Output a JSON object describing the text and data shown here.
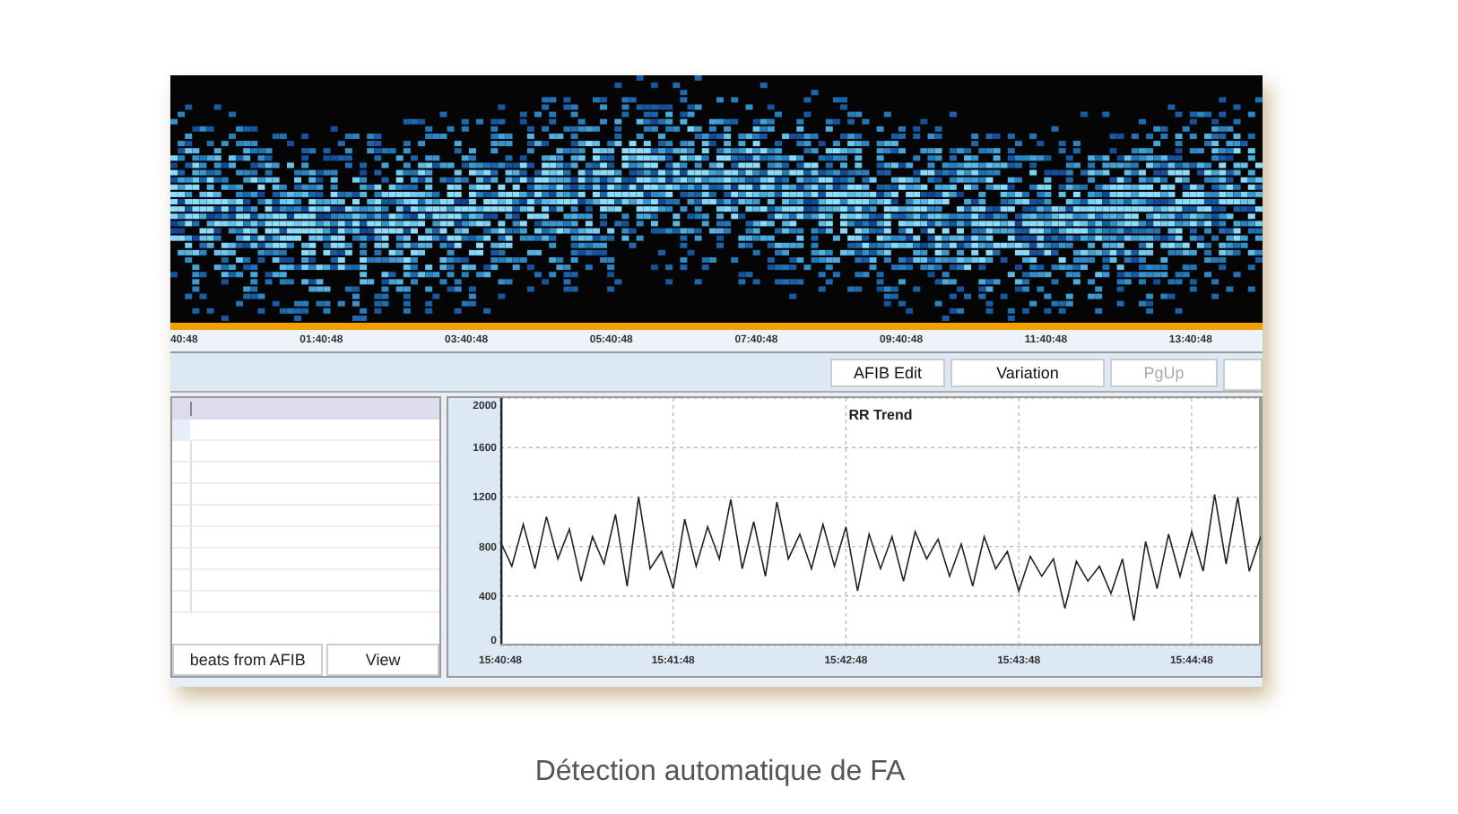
{
  "spectrogram": {
    "time_labels": [
      "40:48",
      "01:40:48",
      "03:40:48",
      "05:40:48",
      "07:40:48",
      "09:40:48",
      "11:40:48",
      "13:40:48"
    ]
  },
  "toolbar": {
    "buttons": [
      {
        "label": "AFIB Edit",
        "disabled": false
      },
      {
        "label": "Variation",
        "disabled": false
      },
      {
        "label": "PgUp",
        "disabled": true
      }
    ]
  },
  "event_list": {
    "buttons": [
      "beats from AFIB",
      "View"
    ]
  },
  "trend": {
    "chart_data": {
      "type": "line",
      "title": "RR Trend",
      "x": [
        56448,
        56452,
        56456,
        56460,
        56464,
        56468,
        56472,
        56476,
        56480,
        56484,
        56488,
        56492,
        56496,
        56500,
        56504,
        56508,
        56512,
        56516,
        56520,
        56524,
        56528,
        56532,
        56536,
        56540,
        56544,
        56548,
        56552,
        56556,
        56560,
        56564,
        56568,
        56572,
        56576,
        56580,
        56584,
        56588,
        56592,
        56596,
        56600,
        56604,
        56608,
        56612,
        56616,
        56620,
        56624,
        56628,
        56632,
        56636,
        56640,
        56644,
        56648,
        56652,
        56656,
        56660,
        56664,
        56668,
        56672,
        56676,
        56680,
        56684,
        56688,
        56692,
        56696,
        56700,
        56704,
        56708,
        56712
      ],
      "series": [
        {
          "color": "#222222",
          "values": [
            840,
            640,
            980,
            620,
            1040,
            700,
            940,
            520,
            880,
            660,
            1060,
            480,
            1200,
            620,
            760,
            460,
            1020,
            640,
            960,
            700,
            1180,
            620,
            1000,
            560,
            1160,
            700,
            900,
            620,
            980,
            640,
            960,
            440,
            900,
            620,
            880,
            520,
            920,
            700,
            860,
            560,
            820,
            480,
            880,
            620,
            760,
            440,
            720,
            560,
            700,
            300,
            680,
            520,
            640,
            420,
            700,
            200,
            840,
            460,
            900,
            560,
            920,
            600,
            1220,
            660,
            1200,
            600,
            880
          ]
        }
      ],
      "grid": true,
      "xlim": [
        56448,
        56712
      ],
      "ylim": [
        0,
        2000
      ],
      "yticks": [
        0,
        400,
        800,
        1200,
        1600,
        2000
      ],
      "xticks": [
        {
          "value": 56448,
          "label": "15:40:48"
        },
        {
          "value": 56508,
          "label": "15:41:48"
        },
        {
          "value": 56568,
          "label": "15:42:48"
        },
        {
          "value": 56628,
          "label": "15:43:48"
        },
        {
          "value": 56688,
          "label": "15:44:48"
        }
      ]
    }
  },
  "caption": "Détection automatique de FA"
}
